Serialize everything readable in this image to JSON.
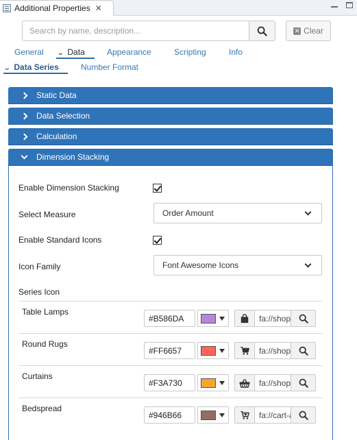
{
  "view": {
    "title": "Additional Properties",
    "close_glyph": "✕"
  },
  "search": {
    "placeholder": "Search by name, description...",
    "value": "",
    "clear_label": "Clear"
  },
  "main_tabs": [
    {
      "label": "General",
      "active": false
    },
    {
      "label": "Data",
      "active": true
    },
    {
      "label": "Appearance",
      "active": false
    },
    {
      "label": "Scripting",
      "active": false
    },
    {
      "label": "Info",
      "active": false
    }
  ],
  "sub_tabs": [
    {
      "label": "Data Series",
      "active": true
    },
    {
      "label": "Number Format",
      "active": false
    }
  ],
  "sections": [
    {
      "label": "Static Data",
      "expanded": false
    },
    {
      "label": "Data Selection",
      "expanded": false
    },
    {
      "label": "Calculation",
      "expanded": false
    },
    {
      "label": "Dimension Stacking",
      "expanded": true
    }
  ],
  "dimension_stacking": {
    "enable_label": "Enable Dimension Stacking",
    "enable_checked": true,
    "measure_label": "Select Measure",
    "measure_value": "Order Amount",
    "icons_label": "Enable Standard Icons",
    "icons_checked": true,
    "family_label": "Icon Family",
    "family_value": "Font Awesome Icons",
    "series_icon_label": "Series Icon"
  },
  "series": [
    {
      "name": "Table Lamps",
      "color": "#B586DA",
      "icon": "shopping-bag-icon",
      "icon_value": "fa://shopping-bag"
    },
    {
      "name": "Round Rugs",
      "color": "#FF6657",
      "icon": "shopping-cart-icon",
      "icon_value": "fa://shopping-cart"
    },
    {
      "name": "Curtains",
      "color": "#F3A730",
      "icon": "shopping-basket-icon",
      "icon_value": "fa://shopping-basket"
    },
    {
      "name": "Bedspread",
      "color": "#946B66",
      "icon": "cart-arrow-down-icon",
      "icon_value": "fa://cart-arrow-down"
    }
  ],
  "colors": {
    "accent": "#2F73B8",
    "link": "#3A78B7"
  }
}
